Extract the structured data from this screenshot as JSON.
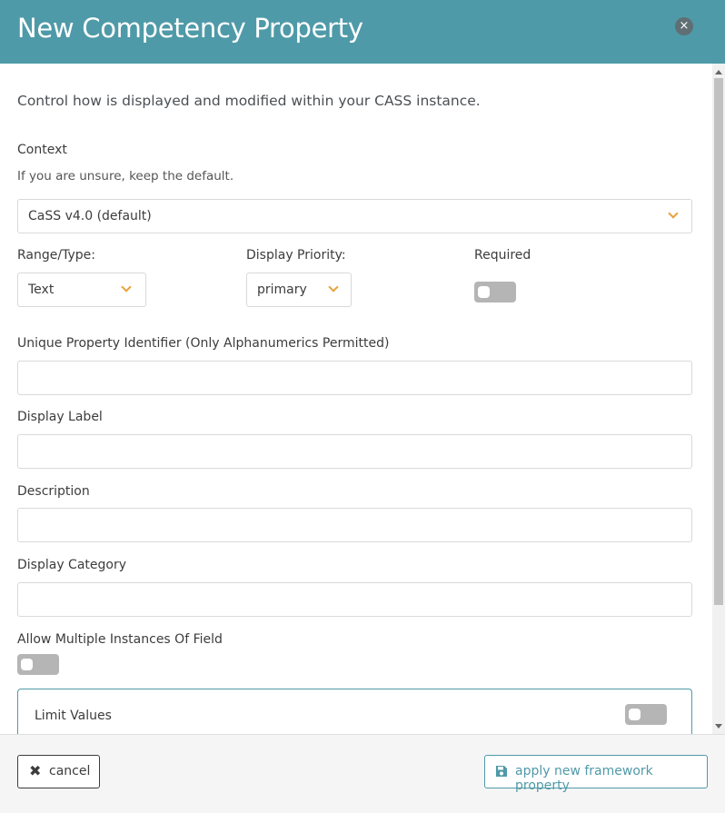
{
  "header": {
    "title": "New Competency Property",
    "close_icon": "close-icon",
    "close_glyph": "×"
  },
  "intro": "Control how is displayed and modified within your CASS instance.",
  "context": {
    "label": "Context",
    "help": "If you are unsure, keep the default.",
    "selected": "CaSS v4.0 (default)"
  },
  "range_type": {
    "label": "Range/Type:",
    "selected": "Text"
  },
  "display_priority": {
    "label": "Display Priority:",
    "selected": "primary"
  },
  "required": {
    "label": "Required",
    "on": false
  },
  "unique_identifier": {
    "label": "Unique Property Identifier (Only Alphanumerics Permitted)",
    "value": ""
  },
  "display_label": {
    "label": "Display Label",
    "value": ""
  },
  "description": {
    "label": "Description",
    "value": ""
  },
  "display_category": {
    "label": "Display Category",
    "value": ""
  },
  "allow_multiple": {
    "label": "Allow Multiple Instances Of Field",
    "on": false
  },
  "limit_values": {
    "label": "Limit Values",
    "on": false
  },
  "footer": {
    "cancel_glyph": "✖",
    "cancel_label": "cancel",
    "apply_label": "apply new framework property",
    "apply_icon": "save-icon"
  },
  "colors": {
    "header": "#4f9aa8",
    "accent_chevron": "#e8a13a",
    "toggle_off": "#b5b5b5"
  }
}
